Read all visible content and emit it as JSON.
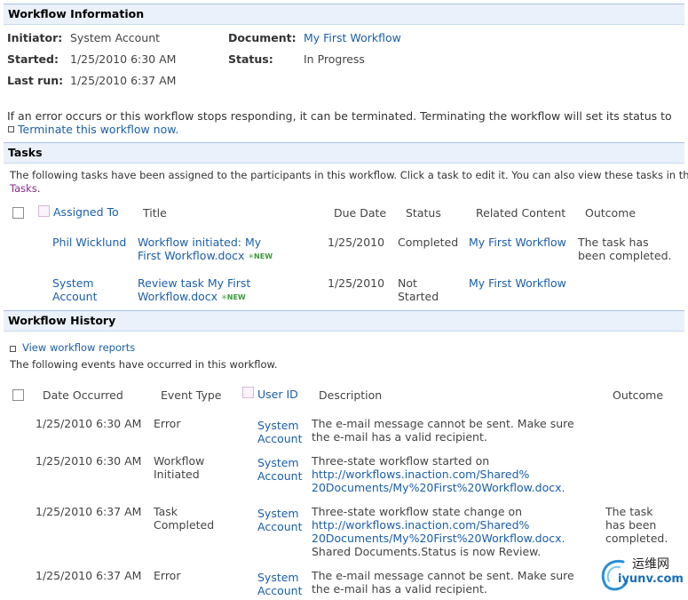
{
  "workflow_info": {
    "header": "Workflow Information",
    "initiator_label": "Initiator:",
    "initiator_value": "System Account",
    "document_label": "Document:",
    "document_value": "My First Workflow",
    "started_label": "Started:",
    "started_value": "1/25/2010 6:30 AM",
    "status_label": "Status:",
    "status_value": "In Progress",
    "lastrun_label": "Last run:",
    "lastrun_value": "1/25/2010 6:37 AM",
    "error_text": "If an error occurs or this workflow stops responding, it can be terminated. Terminating the workflow will set its status to",
    "terminate_link": "Terminate this workflow now."
  },
  "tasks": {
    "header": "Tasks",
    "intro_line1": "The following tasks have been assigned to the participants in this workflow. Click a task to edit it. You can also view these tasks in the list",
    "intro_link": "Tasks",
    "intro_end": ".",
    "columns": [
      "Assigned To",
      "Title",
      "Due Date",
      "Status",
      "Related Content",
      "Outcome"
    ],
    "rows": [
      {
        "assigned": [
          "Phil Wicklund"
        ],
        "title": [
          "Workflow initiated: My",
          "First Workflow.docx"
        ],
        "new_badge": "NEW",
        "due": "1/25/2010",
        "status": [
          "Completed"
        ],
        "related": "My First Workflow",
        "outcome": [
          "The task has",
          "been completed."
        ]
      },
      {
        "assigned": [
          "System",
          "Account"
        ],
        "title": [
          "Review task My First",
          "Workflow.docx"
        ],
        "new_badge": "NEW",
        "due": "1/25/2010",
        "status": [
          "Not",
          "Started"
        ],
        "related": "My First Workflow",
        "outcome": []
      }
    ]
  },
  "history": {
    "header": "Workflow History",
    "reports_link": "View workflow reports",
    "intro": "The following events have occurred in this workflow.",
    "columns": [
      "Date Occurred",
      "Event Type",
      "User ID",
      "Description",
      "Outcome"
    ],
    "rows": [
      {
        "date": "1/25/2010 6:30 AM",
        "event": [
          "Error"
        ],
        "user": [
          "System",
          "Account"
        ],
        "desc": [
          {
            "t": "The e-mail message cannot be sent. Make sure",
            "link": false
          },
          {
            "t": "the e-mail has a valid recipient.",
            "link": false
          }
        ],
        "outcome": []
      },
      {
        "date": "1/25/2010 6:30 AM",
        "event": [
          "Workflow",
          "Initiated"
        ],
        "user": [
          "System",
          "Account"
        ],
        "desc": [
          {
            "t": "Three-state workflow started on",
            "link": false
          },
          {
            "t": "http://workflows.inaction.com/Shared%",
            "link": true
          },
          {
            "t": "20Documents/My%20First%20Workflow.docx.",
            "link": true
          }
        ],
        "outcome": []
      },
      {
        "date": "1/25/2010 6:37 AM",
        "event": [
          "Task",
          "Completed"
        ],
        "user": [
          "System",
          "Account"
        ],
        "desc": [
          {
            "t": "Three-state workflow state change on",
            "link": false
          },
          {
            "t": "http://workflows.inaction.com/Shared%",
            "link": true
          },
          {
            "t": "20Documents/My%20First%20Workflow.docx.",
            "link": true
          },
          {
            "t": "Shared Documents.Status is now Review.",
            "link": false
          }
        ],
        "outcome": [
          "The task",
          "has been",
          "completed."
        ]
      },
      {
        "date": "1/25/2010 6:37 AM",
        "event": [
          "Error"
        ],
        "user": [
          "System",
          "Account"
        ],
        "desc": [
          {
            "t": "The e-mail message cannot be sent. Make sure",
            "link": false
          },
          {
            "t": "the e-mail has a valid recipient.",
            "link": false
          }
        ],
        "outcome": []
      }
    ]
  },
  "watermark": {
    "line1": "运维网",
    "line2": "iyunv.com"
  }
}
